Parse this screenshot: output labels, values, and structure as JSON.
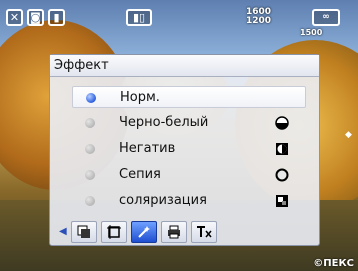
{
  "status_bar": {
    "icons": [
      "close-icon",
      "camera-mode-icon",
      "display-icon",
      "battery-icon",
      "resolution-icon",
      "shots-remaining-icon"
    ],
    "resolution_top": "1600",
    "resolution_bottom": "1200",
    "shots": "1500"
  },
  "effect_menu": {
    "title": "Эффект",
    "selected_index": 0,
    "options": [
      {
        "label": "Норм.",
        "icon": ""
      },
      {
        "label": "Черно-белый",
        "icon": "half-circle-icon"
      },
      {
        "label": "Негатив",
        "icon": "negative-icon"
      },
      {
        "label": "Сепия",
        "icon": "sepia-ring-icon"
      },
      {
        "label": "соляризация",
        "icon": "solarize-icon"
      }
    ]
  },
  "toolbar_tabs": [
    "frame-tab-icon",
    "crop-tab-icon",
    "effect-wand-icon",
    "print-tab-icon",
    "text-size-icon"
  ],
  "active_tab": 2,
  "watermark": "©ПЕКС"
}
